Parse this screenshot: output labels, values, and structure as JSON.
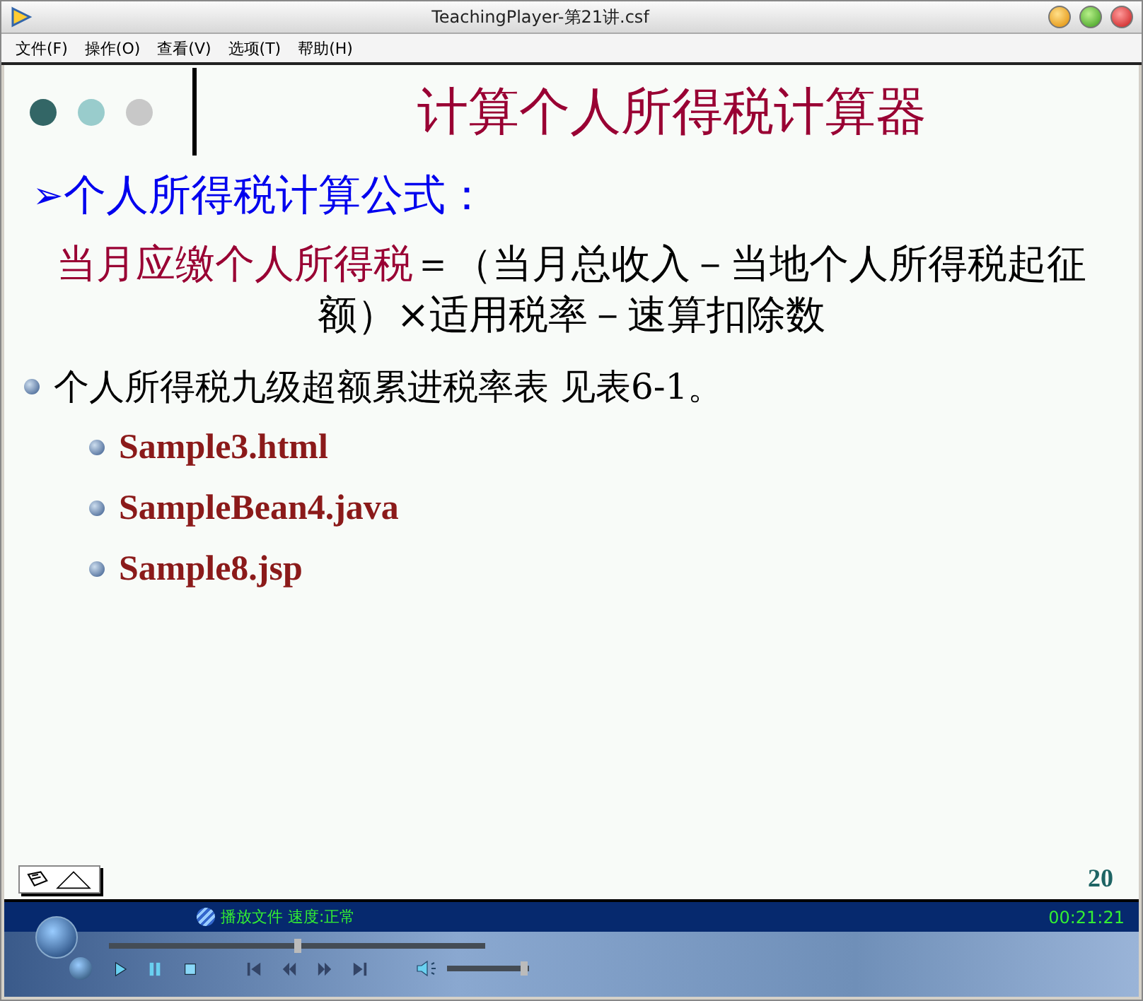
{
  "window": {
    "title": "TeachingPlayer-第21讲.csf"
  },
  "menu": [
    "文件(F)",
    "操作(O)",
    "查看(V)",
    "选项(T)",
    "帮助(H)"
  ],
  "slide": {
    "dots": [
      {
        "color": "#336666"
      },
      {
        "color": "#99cccc"
      },
      {
        "color": "#c8c8c8"
      }
    ],
    "title": "计算个人所得税计算器",
    "heading": {
      "marker": "➢",
      "text": "个人所得税计算公式："
    },
    "formula": {
      "term": "当月应缴个人所得税",
      "expression": "＝（当月总收入－当地个人所得税起征额）×适用税率－速算扣除数"
    },
    "bullets": [
      {
        "kind": "main",
        "text": "个人所得税九级超额累进税率表 见表6-1。"
      },
      {
        "kind": "sub",
        "text": "Sample3.html"
      },
      {
        "kind": "sub",
        "text": "SampleBean4.java"
      },
      {
        "kind": "sub",
        "text": "Sample8.jsp"
      }
    ],
    "page_number": "20"
  },
  "player": {
    "status": "播放文件 速度:正常",
    "time": "00:21:21",
    "progress": {
      "level": 0.5
    },
    "volume": {
      "level": 0.95
    }
  }
}
